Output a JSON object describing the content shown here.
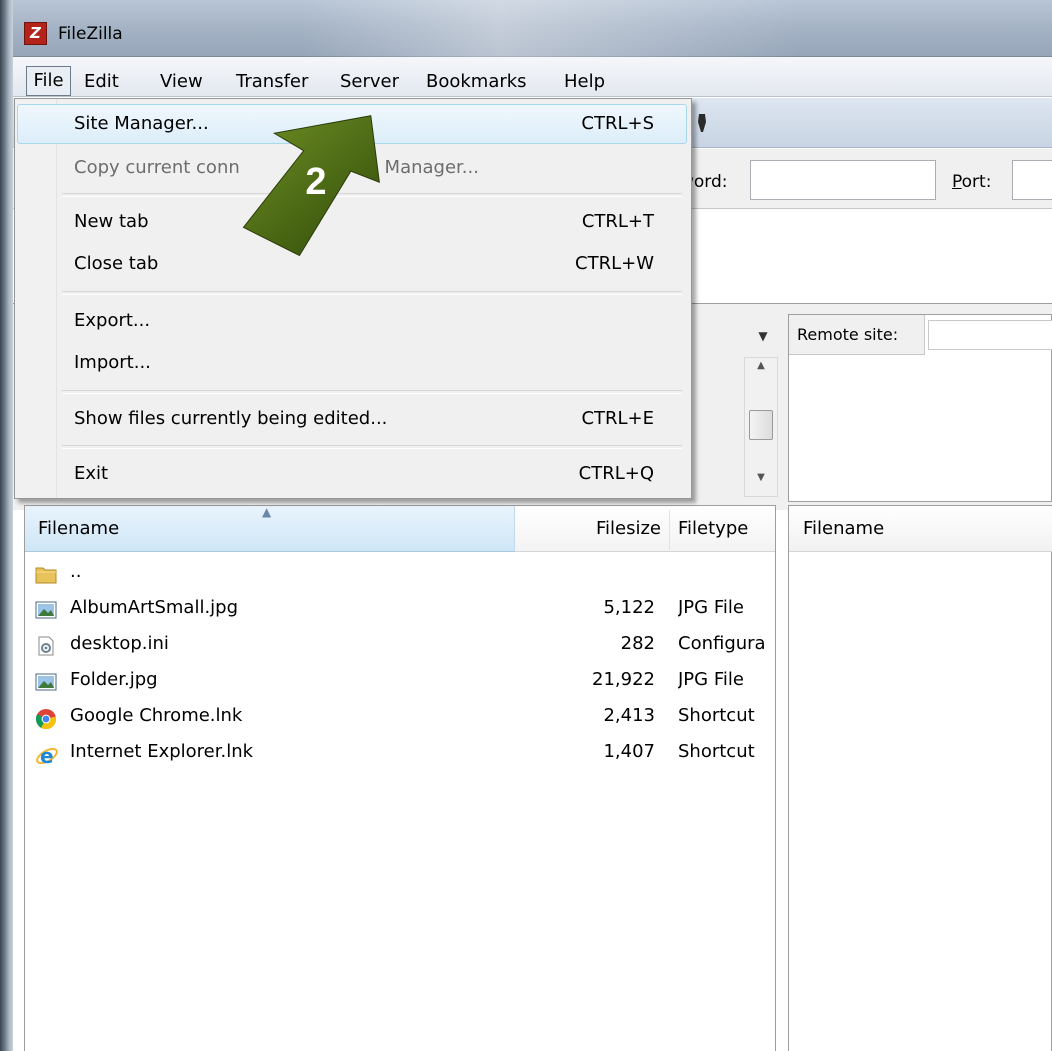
{
  "window": {
    "title": "FileZilla",
    "app_icon": "filezilla-icon"
  },
  "menubar": {
    "items": [
      {
        "label": "File"
      },
      {
        "label": "Edit"
      },
      {
        "label": "View"
      },
      {
        "label": "Transfer"
      },
      {
        "label": "Server"
      },
      {
        "label": "Bookmarks"
      },
      {
        "label": "Help"
      }
    ]
  },
  "file_menu": {
    "items": [
      {
        "label": "Site Manager...",
        "shortcut": "CTRL+S",
        "highlighted": true
      },
      {
        "label": "Copy current conn",
        "label_tail": "e Manager...",
        "disabled": true
      },
      {
        "label": "New tab",
        "shortcut": "CTRL+T"
      },
      {
        "label": "Close tab",
        "shortcut": "CTRL+W"
      },
      {
        "label": "Export..."
      },
      {
        "label": "Import..."
      },
      {
        "label": "Show files currently being edited...",
        "shortcut": "CTRL+E"
      },
      {
        "label": "Exit",
        "shortcut": "CTRL+Q"
      }
    ]
  },
  "quickconnect": {
    "password_label": "word:",
    "port_label": "Port:"
  },
  "remote": {
    "site_label": "Remote site:",
    "filename_header": "Filename"
  },
  "local_list": {
    "headers": {
      "filename": "Filename",
      "filesize": "Filesize",
      "filetype": "Filetype"
    },
    "rows": [
      {
        "name": "..",
        "size": "",
        "type": "",
        "icon": "folder-icon"
      },
      {
        "name": "AlbumArtSmall.jpg",
        "size": "5,122",
        "type": "JPG File",
        "icon": "image-file-icon"
      },
      {
        "name": "desktop.ini",
        "size": "282",
        "type": "Configura",
        "icon": "config-file-icon"
      },
      {
        "name": "Folder.jpg",
        "size": "21,922",
        "type": "JPG File",
        "icon": "image-file-icon"
      },
      {
        "name": "Google Chrome.lnk",
        "size": "2,413",
        "type": "Shortcut",
        "icon": "chrome-icon"
      },
      {
        "name": "Internet Explorer.lnk",
        "size": "1,407",
        "type": "Shortcut",
        "icon": "ie-icon"
      }
    ]
  },
  "annotation": {
    "step_number": "2",
    "color": "#3d5a0e"
  }
}
